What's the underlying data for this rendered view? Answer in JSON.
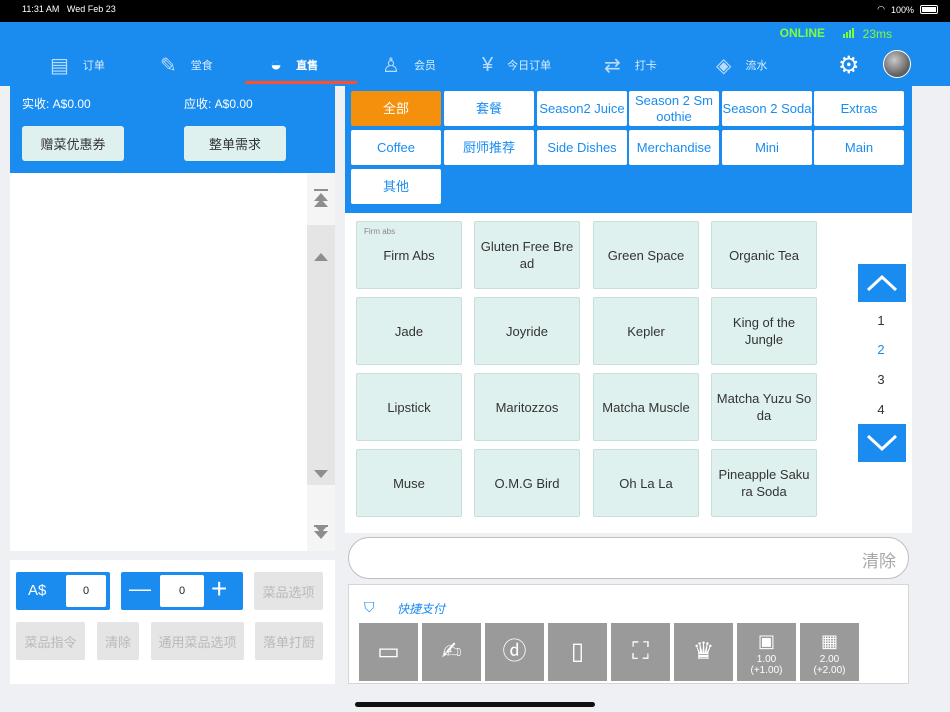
{
  "status": {
    "time": "11:31 AM",
    "date": "Wed Feb 23",
    "battery": "100%"
  },
  "connection": {
    "status": "ONLINE",
    "latency": "23ms"
  },
  "nav": {
    "items": [
      {
        "label": "订单",
        "icon": "document-icon"
      },
      {
        "label": "堂食",
        "icon": "edit-icon"
      },
      {
        "label": "直售",
        "icon": "bowl-icon"
      },
      {
        "label": "会员",
        "icon": "member-icon"
      },
      {
        "label": "今日订单",
        "icon": "yen-icon"
      },
      {
        "label": "打卡",
        "icon": "transfer-icon"
      },
      {
        "label": "流水",
        "icon": "layers-icon"
      }
    ],
    "active": "直售"
  },
  "order": {
    "actual_label": "实收: A$0.00",
    "due_label": "应收: A$0.00",
    "coupon_button": "赠菜优惠券",
    "whole_order_button": "整单需求",
    "currency": "A$",
    "amount_value": "0",
    "quantity_value": "0",
    "dish_options": "菜品选项",
    "dish_command": "菜品指令",
    "clear": "清除",
    "common_options": "通用菜品选项",
    "send_print": "落单打厨"
  },
  "categories": {
    "row1": [
      "全部",
      "套餐",
      "Season2 Juice",
      "Season 2 Sm oothie",
      "Season 2 Soda",
      "Extras"
    ],
    "row2": [
      "Coffee",
      "厨师推荐",
      "Side Dishes",
      "Merchandise",
      "Mini",
      "Main"
    ],
    "row3": [
      "其他"
    ],
    "active": "全部"
  },
  "items": {
    "first_tag": "Firm abs",
    "rows": [
      [
        "Firm Abs",
        "Gluten Free Bre ad",
        "Green Space",
        "Organic Tea"
      ],
      [
        "Jade",
        "Joyride",
        "Kepler",
        "King of the Jungle"
      ],
      [
        "Lipstick",
        "Maritozzos",
        "Matcha Muscle",
        "Matcha Yuzu So da"
      ],
      [
        "Muse",
        "O.M.G Bird",
        "Oh La La",
        "Pineapple Saku ra Soda"
      ]
    ]
  },
  "pagination": {
    "pages": [
      "1",
      "2",
      "3",
      "4"
    ],
    "current": "2"
  },
  "search": {
    "clear_label": "清除"
  },
  "payment": {
    "title": "快捷支付",
    "cash_1": "1.00",
    "cash_1_sub": "(+1.00)",
    "cash_2": "2.00",
    "cash_2_sub": "(+2.00)"
  },
  "colors": {
    "primary": "#1a8cf0",
    "active_category": "#f5900c",
    "online": "#7cff3a",
    "tab_indicator": "#ff4e2a"
  }
}
